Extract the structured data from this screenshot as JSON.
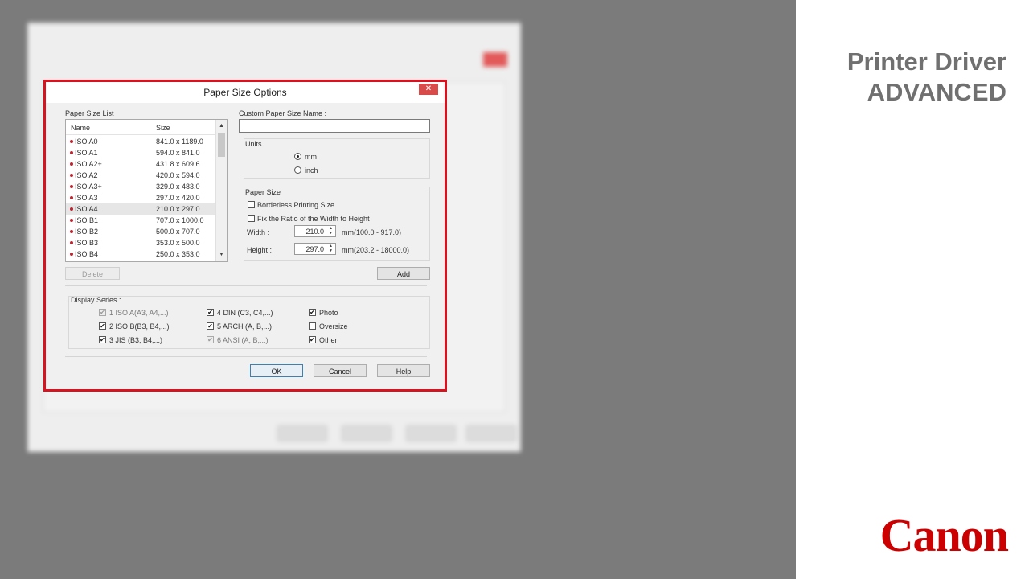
{
  "brand": {
    "title_line1": "Printer Driver",
    "title_line2": "ADVANCED",
    "logo_text": "Canon",
    "accent_color": "#cc0000"
  },
  "dialog": {
    "title": "Paper Size Options",
    "close_glyph": "✕",
    "paper_size_list_label": "Paper Size List",
    "columns": [
      "Name",
      "Size"
    ],
    "rows": [
      {
        "name": "ISO A0",
        "size": "841.0 x 1189.0"
      },
      {
        "name": "ISO A1",
        "size": "594.0 x 841.0"
      },
      {
        "name": "ISO A2+",
        "size": "431.8 x 609.6"
      },
      {
        "name": "ISO A2",
        "size": "420.0 x 594.0"
      },
      {
        "name": "ISO A3+",
        "size": "329.0 x 483.0"
      },
      {
        "name": "ISO A3",
        "size": "297.0 x 420.0"
      },
      {
        "name": "ISO A4",
        "size": "210.0 x 297.0"
      },
      {
        "name": "ISO B1",
        "size": "707.0 x 1000.0"
      },
      {
        "name": "ISO B2",
        "size": "500.0 x 707.0"
      },
      {
        "name": "ISO B3",
        "size": "353.0 x 500.0"
      },
      {
        "name": "ISO B4",
        "size": "250.0 x 353.0"
      }
    ],
    "selected_row": "ISO A4",
    "delete_label": "Delete",
    "custom_name_label": "Custom Paper Size Name :",
    "custom_name_value": "",
    "units_label": "Units",
    "unit_mm": "mm",
    "unit_inch": "inch",
    "selected_unit": "mm",
    "paper_size_label": "Paper Size",
    "borderless_label": "Borderless Printing Size",
    "fix_ratio_label": "Fix the Ratio of the Width to Height",
    "width_label": "Width :",
    "width_value": "210.0",
    "width_range": "mm(100.0 - 917.0)",
    "height_label": "Height :",
    "height_value": "297.0",
    "height_range": "mm(203.2 - 18000.0)",
    "add_label": "Add",
    "display_series_label": "Display Series :",
    "series": [
      {
        "label": "1 ISO A(A3, A4,...)",
        "checked": true,
        "enabled": false
      },
      {
        "label": "2 ISO B(B3, B4,...)",
        "checked": true,
        "enabled": true
      },
      {
        "label": "3 JIS (B3, B4,...)",
        "checked": true,
        "enabled": true
      },
      {
        "label": "4 DIN (C3, C4,...)",
        "checked": true,
        "enabled": true
      },
      {
        "label": "5 ARCH (A, B,...)",
        "checked": true,
        "enabled": true
      },
      {
        "label": "6 ANSI (A, B,...)",
        "checked": true,
        "enabled": false
      },
      {
        "label": "Photo",
        "checked": true,
        "enabled": true
      },
      {
        "label": "Oversize",
        "checked": false,
        "enabled": true
      },
      {
        "label": "Other",
        "checked": true,
        "enabled": true
      }
    ],
    "ok_label": "OK",
    "cancel_label": "Cancel",
    "help_label": "Help",
    "check_glyph": "✔"
  }
}
